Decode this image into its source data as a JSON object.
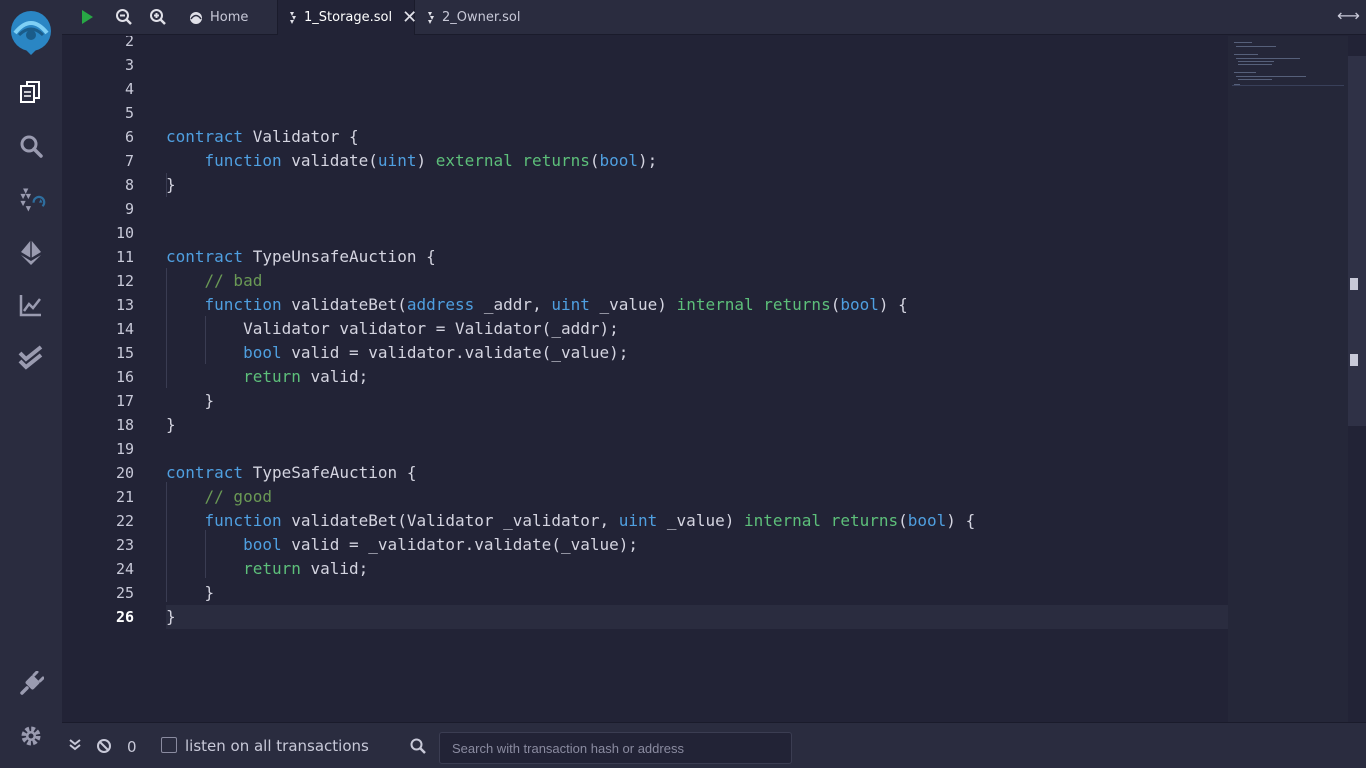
{
  "topbar": {
    "tabs": [
      {
        "label": "Home"
      },
      {
        "label": "1_Storage.sol"
      },
      {
        "label": "2_Owner.sol"
      }
    ],
    "close_glyph": "✕",
    "expand_glyph": "⟷"
  },
  "sidebar": {
    "icons": [
      "file-explorer-icon",
      "search-icon",
      "solidity-compiler-icon",
      "deploy-run-icon",
      "analysis-icon",
      "testing-icon",
      "plugin-manager-icon",
      "settings-icon"
    ]
  },
  "editor": {
    "current_line": 26,
    "line_numbers": [
      "2",
      "3",
      "4",
      "5",
      "6",
      "7",
      "8",
      "9",
      "10",
      "11",
      "12",
      "13",
      "14",
      "15",
      "16",
      "17",
      "18",
      "19",
      "20",
      "21",
      "22",
      "23",
      "24",
      "25",
      "26"
    ],
    "lines": [
      [],
      [],
      [],
      [],
      [
        {
          "t": "contract",
          "c": "k"
        },
        {
          "t": " Validator {",
          "c": ""
        }
      ],
      [
        {
          "t": "    ",
          "c": ""
        },
        {
          "t": "function",
          "c": "k"
        },
        {
          "t": " validate(",
          "c": ""
        },
        {
          "t": "uint",
          "c": "k"
        },
        {
          "t": ") ",
          "c": ""
        },
        {
          "t": "external",
          "c": "g"
        },
        {
          "t": " ",
          "c": ""
        },
        {
          "t": "returns",
          "c": "g"
        },
        {
          "t": "(",
          "c": ""
        },
        {
          "t": "bool",
          "c": "k"
        },
        {
          "t": ");",
          "c": ""
        }
      ],
      [
        {
          "t": "}",
          "c": ""
        }
      ],
      [],
      [],
      [
        {
          "t": "contract",
          "c": "k"
        },
        {
          "t": " TypeUnsafeAuction {",
          "c": ""
        }
      ],
      [
        {
          "t": "    ",
          "c": ""
        },
        {
          "t": "// bad",
          "c": "c"
        }
      ],
      [
        {
          "t": "    ",
          "c": ""
        },
        {
          "t": "function",
          "c": "k"
        },
        {
          "t": " validateBet(",
          "c": ""
        },
        {
          "t": "address",
          "c": "k"
        },
        {
          "t": " _addr, ",
          "c": ""
        },
        {
          "t": "uint",
          "c": "k"
        },
        {
          "t": " _value) ",
          "c": ""
        },
        {
          "t": "internal",
          "c": "g"
        },
        {
          "t": " ",
          "c": ""
        },
        {
          "t": "returns",
          "c": "g"
        },
        {
          "t": "(",
          "c": ""
        },
        {
          "t": "bool",
          "c": "k"
        },
        {
          "t": ") {",
          "c": ""
        }
      ],
      [
        {
          "t": "        Validator validator = Validator(_addr);",
          "c": ""
        }
      ],
      [
        {
          "t": "        ",
          "c": ""
        },
        {
          "t": "bool",
          "c": "k"
        },
        {
          "t": " valid = validator.validate(_value);",
          "c": ""
        }
      ],
      [
        {
          "t": "        ",
          "c": ""
        },
        {
          "t": "return",
          "c": "g"
        },
        {
          "t": " valid;",
          "c": ""
        }
      ],
      [
        {
          "t": "    }",
          "c": ""
        }
      ],
      [
        {
          "t": "}",
          "c": ""
        }
      ],
      [],
      [
        {
          "t": "contract",
          "c": "k"
        },
        {
          "t": " TypeSafeAuction {",
          "c": ""
        }
      ],
      [
        {
          "t": "    ",
          "c": ""
        },
        {
          "t": "// good",
          "c": "c"
        }
      ],
      [
        {
          "t": "    ",
          "c": ""
        },
        {
          "t": "function",
          "c": "k"
        },
        {
          "t": " validateBet(Validator _validator, ",
          "c": ""
        },
        {
          "t": "uint",
          "c": "k"
        },
        {
          "t": " _value) ",
          "c": ""
        },
        {
          "t": "internal",
          "c": "g"
        },
        {
          "t": " ",
          "c": ""
        },
        {
          "t": "returns",
          "c": "g"
        },
        {
          "t": "(",
          "c": ""
        },
        {
          "t": "bool",
          "c": "k"
        },
        {
          "t": ") {",
          "c": ""
        }
      ],
      [
        {
          "t": "        ",
          "c": ""
        },
        {
          "t": "bool",
          "c": "k"
        },
        {
          "t": " valid = _validator.validate(_value);",
          "c": ""
        }
      ],
      [
        {
          "t": "        ",
          "c": ""
        },
        {
          "t": "return",
          "c": "g"
        },
        {
          "t": " valid;",
          "c": ""
        }
      ],
      [
        {
          "t": "    }",
          "c": ""
        }
      ],
      [
        {
          "t": "}",
          "c": ""
        }
      ]
    ]
  },
  "bottombar": {
    "count": "0",
    "listen_label": "listen on all transactions",
    "search_placeholder": "Search with transaction hash or address"
  },
  "colors": {
    "keyword": "#4f9fe0",
    "modifier": "#5dbf7a",
    "comment": "#6a9955",
    "run_green": "#28a745",
    "logo_blue": "#2a86c4"
  }
}
